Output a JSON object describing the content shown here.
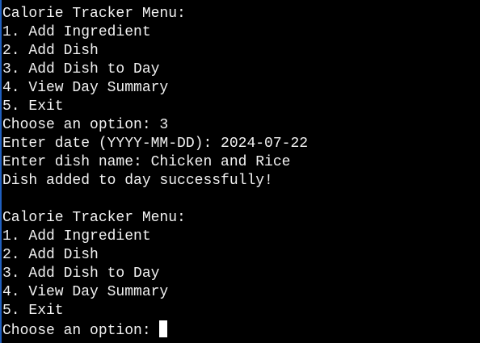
{
  "terminal": {
    "lines": [
      "Calorie Tracker Menu:",
      "1. Add Ingredient",
      "2. Add Dish",
      "3. Add Dish to Day",
      "4. View Day Summary",
      "5. Exit",
      "Choose an option: 3",
      "Enter date (YYYY-MM-DD): 2024-07-22",
      "Enter dish name: Chicken and Rice",
      "Dish added to day successfully!",
      "",
      "Calorie Tracker Menu:",
      "1. Add Ingredient",
      "2. Add Dish",
      "3. Add Dish to Day",
      "4. View Day Summary",
      "5. Exit"
    ],
    "prompt": "Choose an option: "
  }
}
